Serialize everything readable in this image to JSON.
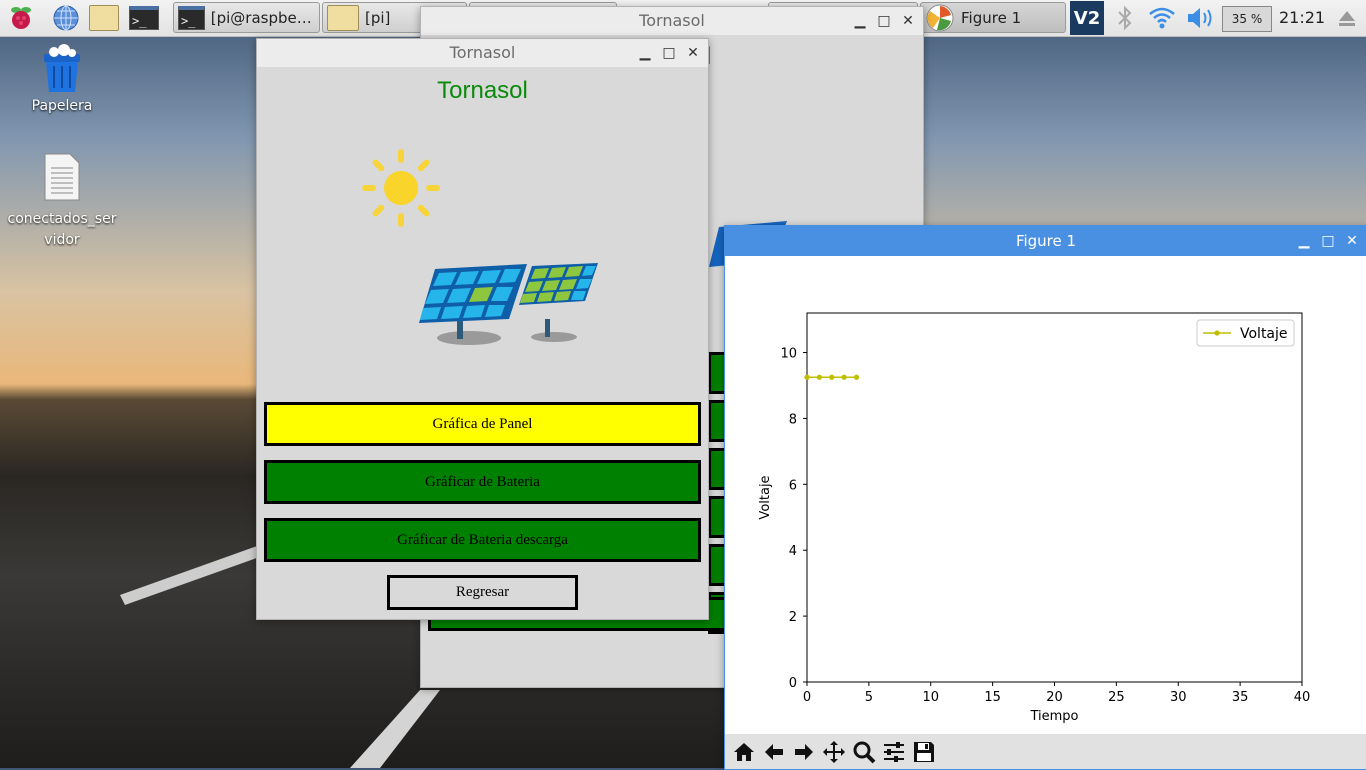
{
  "taskbar": {
    "tasks": [
      {
        "label": "[pi@raspberry..."
      },
      {
        "label": "[pi]"
      },
      {
        "label": "Tornasol"
      },
      {
        "label": "Figure 1"
      }
    ],
    "cpu": "35 %",
    "clock": "21:21"
  },
  "desktop": {
    "icons": [
      {
        "label": "Papelera"
      },
      {
        "label": "conectados_servidor"
      }
    ]
  },
  "back_window": {
    "title": "Tornasol"
  },
  "main_window": {
    "title": "Tornasol",
    "app_title": "Tornasol",
    "buttons": [
      {
        "label": "Gráfica de Panel",
        "color": "#ffff00"
      },
      {
        "label": "Gráficar de Bateria",
        "color": "#008000"
      },
      {
        "label": "Gráficar de Bateria descarga",
        "color": "#008000"
      }
    ],
    "back_label": "Regresar"
  },
  "figure": {
    "window_title": "Figure 1",
    "toolbar": [
      "home-icon",
      "back-icon",
      "forward-icon",
      "pan-icon",
      "zoom-icon",
      "configure-icon",
      "save-icon"
    ]
  },
  "chart_data": {
    "type": "line",
    "title": "",
    "xlabel": "Tiempo",
    "ylabel": "Voltaje",
    "xlim": [
      0,
      40
    ],
    "ylim": [
      0,
      11.2
    ],
    "xticks": [
      0,
      5,
      10,
      15,
      20,
      25,
      30,
      35,
      40
    ],
    "yticks": [
      0,
      2,
      4,
      6,
      8,
      10
    ],
    "legend": "top-right",
    "grid": false,
    "series": [
      {
        "name": "Voltaje",
        "color": "#bfbf00",
        "x": [
          0,
          1,
          2,
          3,
          4
        ],
        "y": [
          9.25,
          9.25,
          9.25,
          9.25,
          9.25
        ]
      }
    ]
  }
}
